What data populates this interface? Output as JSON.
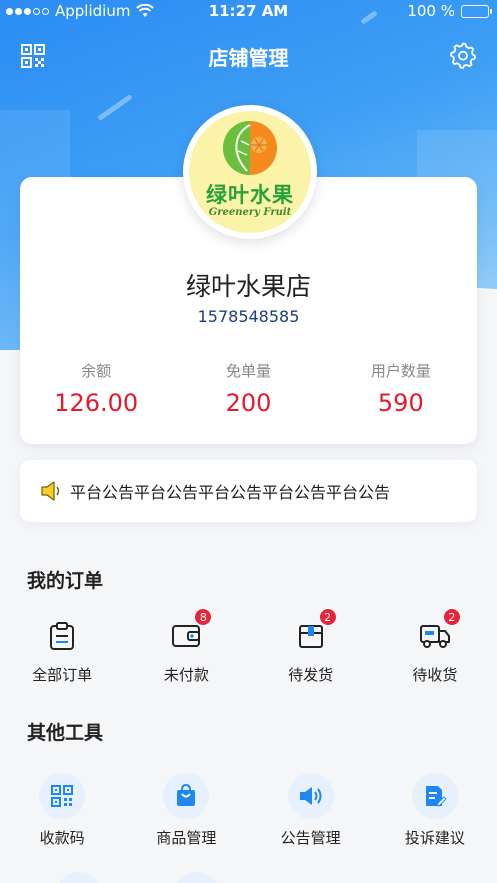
{
  "status_bar": {
    "carrier": "Applidium",
    "time": "11:27 AM",
    "battery": "100 %"
  },
  "nav": {
    "title": "店铺管理"
  },
  "shop": {
    "logo_text_cn": "绿叶水果",
    "logo_text_en": "Greenery Fruit",
    "name": "绿叶水果店",
    "phone": "1578548585",
    "stats": [
      {
        "label": "余额",
        "value": "126.00"
      },
      {
        "label": "免单量",
        "value": "200"
      },
      {
        "label": "用户数量",
        "value": "590"
      }
    ]
  },
  "notice": {
    "text": "平台公告平台公告平台公告平台公告平台公告"
  },
  "orders": {
    "title": "我的订单",
    "items": [
      {
        "label": "全部订单",
        "icon": "clipboard-icon",
        "badge": ""
      },
      {
        "label": "未付款",
        "icon": "wallet-icon",
        "badge": "8"
      },
      {
        "label": "待发货",
        "icon": "box-icon",
        "badge": "2"
      },
      {
        "label": "待收货",
        "icon": "truck-icon",
        "badge": "2"
      }
    ]
  },
  "tools": {
    "title": "其他工具",
    "items": [
      {
        "label": "收款码",
        "icon": "qr-code-icon"
      },
      {
        "label": "商品管理",
        "icon": "shopping-bag-icon"
      },
      {
        "label": "公告管理",
        "icon": "speaker-icon"
      },
      {
        "label": "投诉建议",
        "icon": "edit-document-icon"
      }
    ]
  },
  "colors": {
    "primary": "#2b8cf3",
    "accent_red": "#e21b2d",
    "badge_red": "#e8243b",
    "tool_bg": "#e6f1fd"
  }
}
